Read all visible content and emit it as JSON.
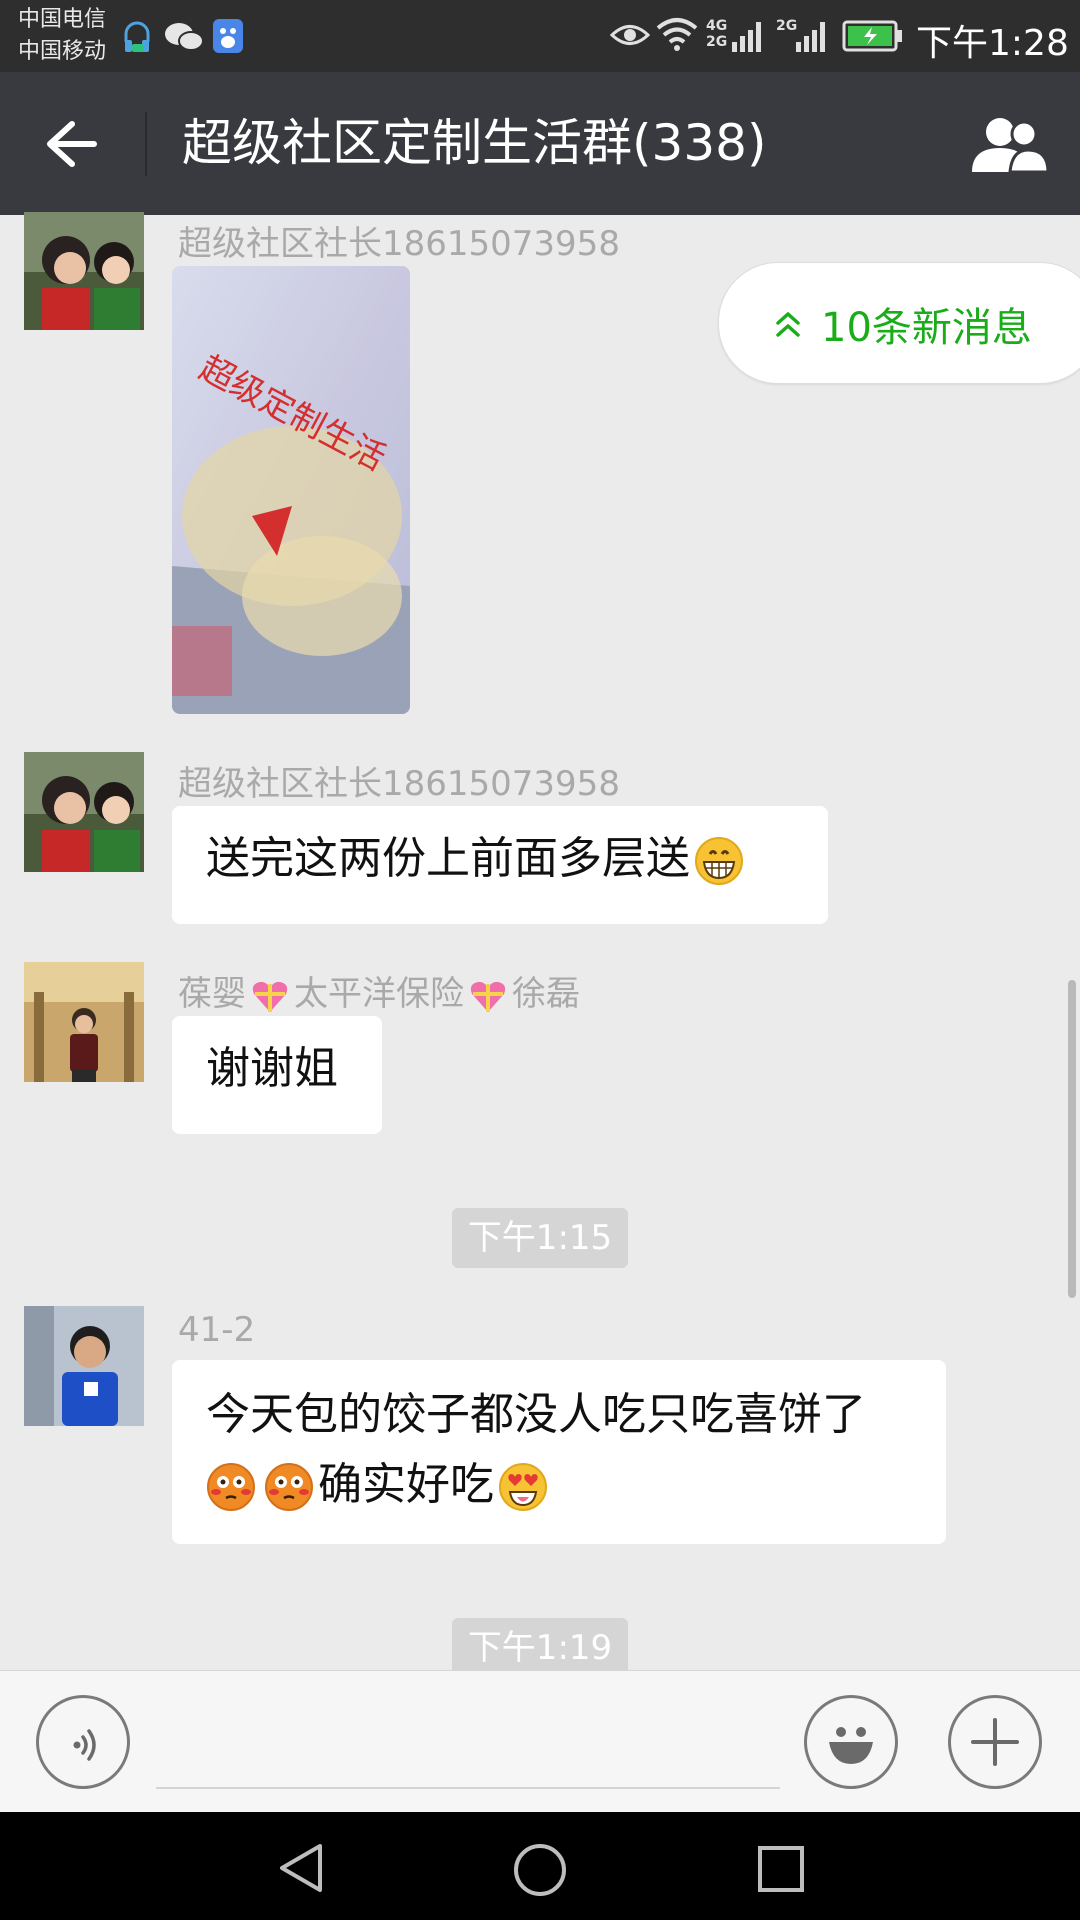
{
  "status_bar": {
    "carrier_1": "中国电信",
    "carrier_2": "中国移动",
    "net_1": "4G",
    "net_2": "2G",
    "net_3": "2G",
    "time": "下午1:28"
  },
  "header": {
    "title": "超级社区定制生活群(338)"
  },
  "new_messages": {
    "label": "10条新消息",
    "accent": "#1aad19"
  },
  "messages": [
    {
      "sender": "超级社区社长18615073958",
      "type": "image",
      "image_text": "超级定制生活"
    },
    {
      "sender": "超级社区社长18615073958",
      "type": "text",
      "text": "送完这两份上前面多层送",
      "emoji": [
        "grin-icon"
      ]
    },
    {
      "sender_parts": [
        "葆婴",
        "太平洋保险",
        "徐磊"
      ],
      "sender_icons": [
        "heart-gift-icon",
        "heart-gift-icon"
      ],
      "type": "text",
      "text": "谢谢姐"
    },
    {
      "type": "time",
      "text": "下午1:15"
    },
    {
      "sender": "41-2",
      "type": "text",
      "text_line1": "今天包的饺子都没人吃只吃喜饼了",
      "text_line2": "确实好吃",
      "emoji": [
        "flushed-icon",
        "flushed-icon",
        "heart-eyes-icon"
      ]
    },
    {
      "type": "time",
      "text": "下午1:19"
    }
  ],
  "colors": {
    "titlebar": "#393a3f",
    "statusbar": "#2e2e2e",
    "background": "#ebebeb"
  }
}
